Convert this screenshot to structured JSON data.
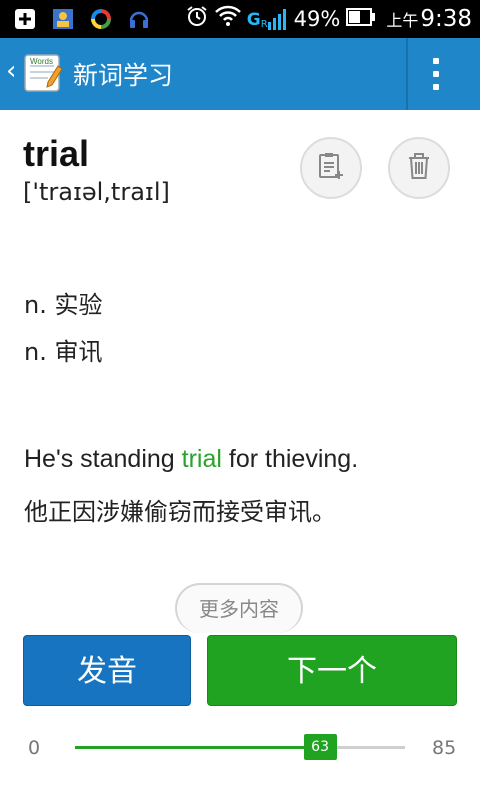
{
  "status_bar": {
    "signal_label": "G",
    "signal_sup": "R",
    "battery_percent": "49%",
    "time_prefix": "上午",
    "time": "9:38",
    "icons": [
      "notification-add-icon",
      "contact-icon",
      "sync-app-icon",
      "headset-icon",
      "alarm-icon",
      "wifi-icon",
      "cell-signal-icon",
      "battery-icon"
    ]
  },
  "titlebar": {
    "back_icon": "chevron-left-icon",
    "app_icon": "notebook-icon",
    "title": "新词学习",
    "menu_icon": "overflow-menu-icon"
  },
  "word": {
    "text": "trial",
    "phonetic": "['traɪəl,traɪl]"
  },
  "actions": {
    "add_note_icon": "note-add-icon",
    "delete_icon": "trash-icon"
  },
  "meanings": [
    "n. 实验",
    "n. 审讯"
  ],
  "example": {
    "en_before": "He's standing ",
    "en_highlight": "trial",
    "en_after": " for thieving.",
    "cn": "他正因涉嫌偷窃而接受审讯。"
  },
  "more_label": "更多内容",
  "buttons": {
    "pronounce": "发音",
    "next": "下一个"
  },
  "progress": {
    "min": "0",
    "max": "85",
    "current": "63",
    "value": 63,
    "total": 85
  },
  "colors": {
    "titlebar": "#1e86c9",
    "accent_green": "#20a321",
    "button_blue": "#1774c0",
    "highlight_green": "#2aa32a"
  }
}
